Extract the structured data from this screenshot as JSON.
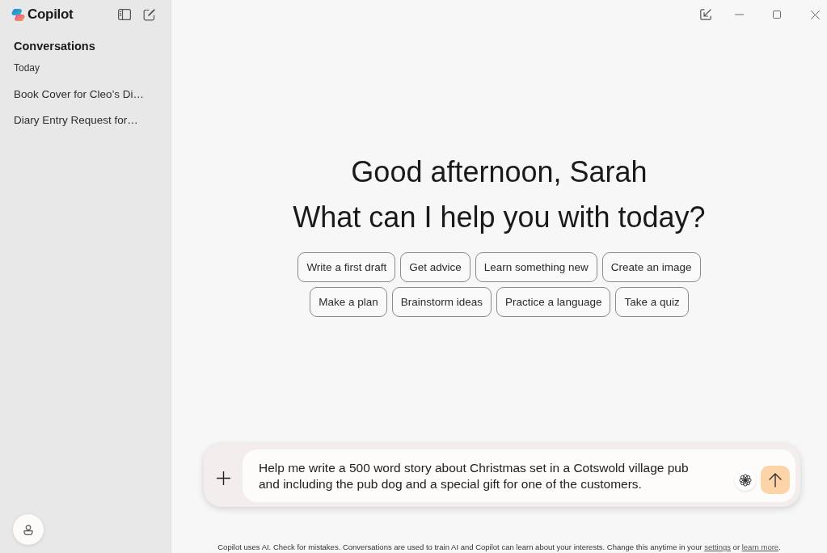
{
  "sidebar": {
    "app_name": "Copilot",
    "section_title": "Conversations",
    "group_label": "Today",
    "conversations": [
      {
        "title": "Book Cover for Cleo’s Di…"
      },
      {
        "title": "Diary Entry Request for…"
      }
    ]
  },
  "main": {
    "greeting": "Good afternoon, Sarah",
    "heading": "What can I help you with today?",
    "suggestion_rows": [
      {
        "chips": [
          "Write a first draft",
          "Get advice",
          "Learn something new",
          "Create an image"
        ]
      },
      {
        "chips": [
          "Make a plan",
          "Brainstorm ideas",
          "Practice a language",
          "Take a quiz"
        ]
      }
    ],
    "composer": {
      "value": "Help me write a 500 word story about Christmas set in a Cotswold village pub and including the pub dog and a special gift for one of the customers."
    },
    "disclaimer": [
      {
        "kind": "text",
        "text": "Copilot uses AI. Check for mistakes. Conversations are used to train AI and Copilot can learn about your interests. Change this anytime in your "
      },
      {
        "kind": "link",
        "text": "settings"
      },
      {
        "kind": "text",
        "text": " or "
      },
      {
        "kind": "link",
        "text": "learn more"
      },
      {
        "kind": "text",
        "text": "."
      }
    ]
  }
}
